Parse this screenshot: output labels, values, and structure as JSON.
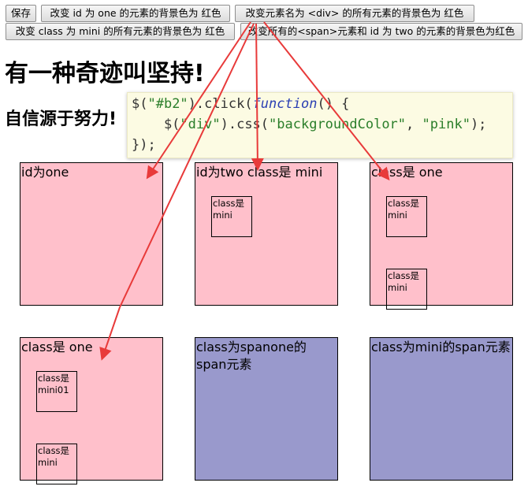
{
  "buttons": {
    "save": "保存",
    "set_one_red": "改变 id 为 one 的元素的背景色为 红色",
    "set_div_red": "改变元素名为 <div> 的所有元素的背景色为 红色",
    "set_mini_red": "改变 class 为 mini 的所有元素的背景色为 红色",
    "set_span_two_red": "改变所有的<span>元素和 id 为 two 的元素的背景色为红色"
  },
  "headings": {
    "main": "有一种奇迹叫坚持!",
    "sub": "自信源于努力!"
  },
  "code": {
    "l1_a": "$(",
    "l1_b": "\"#b2\"",
    "l1_c": ").click(",
    "l1_d": "function",
    "l1_e": "() {",
    "l2_a": "    $(",
    "l2_b": "\"div\"",
    "l2_c": ").css(",
    "l2_d": "\"backgroundColor\"",
    "l2_e": ", ",
    "l2_f": "\"pink\"",
    "l2_g": ");",
    "l3": "});"
  },
  "boxes": {
    "one": "id为one",
    "two": "id为two class是 mini",
    "class_one_a": "class是 one",
    "class_one_b": "class是 one",
    "span_one": "class为spanone的span元素",
    "span_mini": "class为mini的span元素"
  },
  "minis": {
    "two_inner": "class是mini",
    "c1_top": "class是mini",
    "c1_bottom": "class是mini",
    "c2_top": "class是mini01",
    "c2_bottom": "class是mini"
  },
  "colors": {
    "pink": "#ffc0cb",
    "purple": "#9999cc",
    "arrow": "#e83a3a"
  }
}
